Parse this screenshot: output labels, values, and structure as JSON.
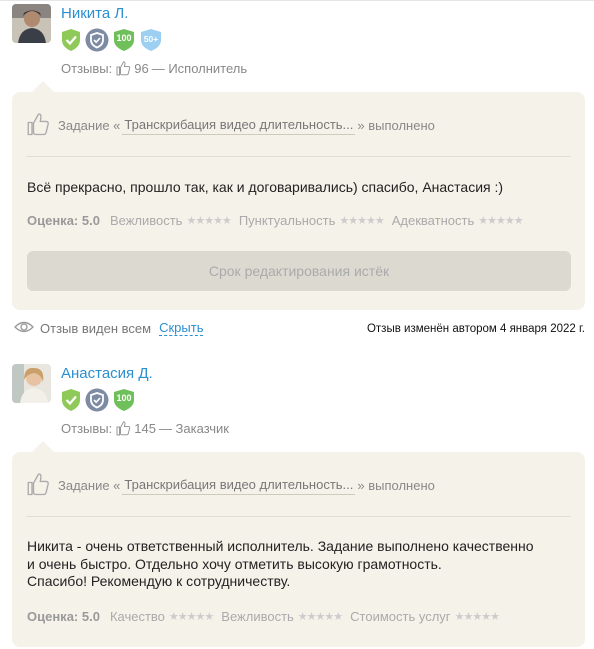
{
  "reviews": [
    {
      "user": {
        "name": "Никита Л."
      },
      "badges": [
        {
          "icon": "verified-check-badge-icon",
          "color": "#8fc95a",
          "text": ""
        },
        {
          "icon": "shield-badge-icon",
          "color": "#8a98b0",
          "text": ""
        },
        {
          "icon": "count-badge-icon",
          "color": "#6fbf5a",
          "text": "100"
        },
        {
          "icon": "count-badge-icon",
          "color": "#9ccff0",
          "text": "50+"
        }
      ],
      "meta": {
        "prefix": "Отзывы:",
        "count": "96",
        "role": "— Исполнитель"
      },
      "task": {
        "prefix": "Задание «",
        "title": "Транскрибация видео длительность...",
        "suffix": "» выполнено"
      },
      "text": "Всё прекрасно, прошло так, как и договаривались) спасибо, Анастасия :)",
      "score": "Оценка: 5.0",
      "categories": [
        "Вежливость",
        "Пунктуальность",
        "Адекватность"
      ],
      "edit_button": "Срок редактирования истёк"
    },
    {
      "user": {
        "name": "Анастасия Д."
      },
      "badges": [
        {
          "icon": "verified-check-badge-icon",
          "color": "#8fc95a",
          "text": ""
        },
        {
          "icon": "shield-badge-icon",
          "color": "#8a98b0",
          "text": ""
        },
        {
          "icon": "count-badge-icon",
          "color": "#6fbf5a",
          "text": "100"
        }
      ],
      "meta": {
        "prefix": "Отзывы:",
        "count": "145",
        "role": "— Заказчик"
      },
      "task": {
        "prefix": "Задание «",
        "title": "Транскрибация видео длительность...",
        "suffix": "» выполнено"
      },
      "text_lines": [
        "Никита - очень ответственный исполнитель. Задание выполнено качественно",
        "и очень быстро. Отдельно хочу отметить высокую грамотность.",
        "Спасибо! Рекомендую к сотрудничеству."
      ],
      "score": "Оценка: 5.0",
      "categories": [
        "Качество",
        "Вежливость",
        "Стоимость услуг"
      ]
    }
  ],
  "visibility": {
    "label": "Отзыв виден всем",
    "hide_link": "Скрыть"
  },
  "edited_note": "Отзыв изменён автором 4 января 2022 г."
}
